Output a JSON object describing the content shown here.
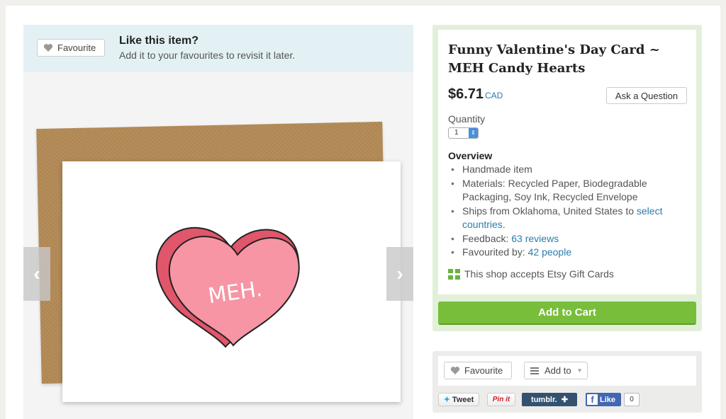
{
  "favourite_banner": {
    "button_label": "Favourite",
    "title": "Like this item?",
    "subtitle": "Add it to your favourites to revisit it later."
  },
  "listing_image": {
    "heart_text": "MEH.",
    "prev_arrow": "‹",
    "next_arrow": "›"
  },
  "listing": {
    "title": "Funny Valentine's Day Card ~ MEH Candy Hearts",
    "price": "$6.71",
    "currency": "CAD",
    "ask_button": "Ask a Question",
    "quantity_label": "Quantity",
    "quantity_value": "1",
    "overview_title": "Overview",
    "overview": {
      "handmade": "Handmade item",
      "materials": "Materials: Recycled Paper, Biodegradable Packaging, Soy Ink, Recycled Envelope",
      "ships_prefix": "Ships from Oklahoma, United States to ",
      "ships_link": "select countries",
      "ships_suffix": ".",
      "feedback_prefix": "Feedback: ",
      "feedback_link": "63 reviews",
      "favourited_prefix": "Favourited by: ",
      "favourited_link": "42 people"
    },
    "gift_cards": "This shop accepts Etsy Gift Cards",
    "add_to_cart": "Add to Cart"
  },
  "social": {
    "favourite_label": "Favourite",
    "add_to_label": "Add to",
    "tweet": "Tweet",
    "pin_it": "Pin it",
    "tumblr": "tumblr.",
    "tumblr_plus": "✚",
    "fb_like": "Like",
    "fb_count": "0"
  },
  "colors": {
    "accent_link": "#2a7dac",
    "cart_green": "#78be3a",
    "banner_blue": "#e3f1f4",
    "buy_box_green": "#e3f0d9"
  }
}
